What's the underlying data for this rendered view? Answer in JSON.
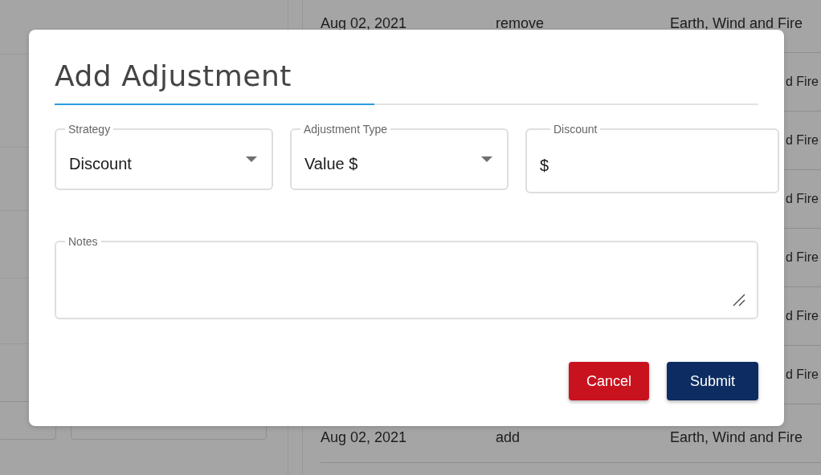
{
  "background_table": {
    "rows": [
      {
        "column_1": "Aug 02, 2021",
        "column_2": "remove",
        "column_3": "Earth, Wind and Fire"
      },
      {
        "column_3": "d Fire"
      },
      {
        "column_3": "d Fire"
      },
      {
        "column_3": "d Fire"
      },
      {
        "column_3": "d Fire"
      },
      {
        "column_3": "d Fire"
      },
      {
        "column_3": "d Fire"
      },
      {
        "column_1": "Aug 02, 2021",
        "column_2": "add",
        "column_3": "Earth, Wind and Fire"
      }
    ]
  },
  "dialog": {
    "title": "Add Adjustment",
    "fields": [
      {
        "kind": "select",
        "label": "Strategy",
        "value": "Discount"
      },
      {
        "kind": "select",
        "label": "Adjustment Type",
        "value": "Value $"
      },
      {
        "kind": "text",
        "label": "Discount",
        "prefix": "$"
      },
      {
        "kind": "textarea",
        "label": "Notes"
      }
    ],
    "buttons": [
      {
        "kind": "cancel",
        "label": "Cancel"
      },
      {
        "kind": "primary",
        "label": "Submit"
      }
    ]
  }
}
